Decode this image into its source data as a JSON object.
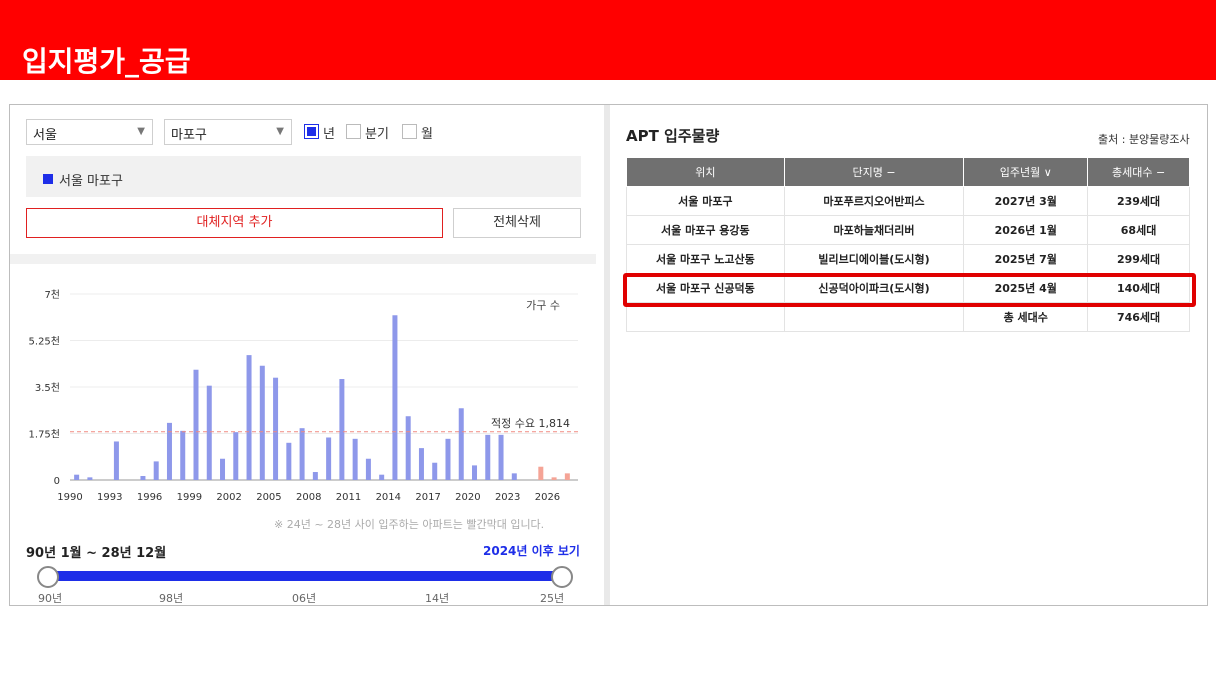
{
  "banner": {
    "title": "입지평가_공급"
  },
  "filters": {
    "city": "서울",
    "district": "마포구",
    "period_options": [
      {
        "label": "년",
        "checked": true
      },
      {
        "label": "분기",
        "checked": false
      },
      {
        "label": "월",
        "checked": false
      }
    ]
  },
  "region_list": {
    "item": "서울 마포구"
  },
  "buttons": {
    "add": "대체지역 추가",
    "clear": "전체삭제"
  },
  "chart_data": {
    "type": "bar",
    "legend_label": "가구 수",
    "y_ticks": [
      "7천",
      "5.25천",
      "3.5천",
      "1.75천",
      "0"
    ],
    "ylim": [
      0,
      7000
    ],
    "x_ticks": [
      "1990",
      "1993",
      "1996",
      "1999",
      "2002",
      "2005",
      "2008",
      "2011",
      "2014",
      "2017",
      "2020",
      "2023",
      "2026"
    ],
    "reference_line": {
      "label": "적정 수요 1,814",
      "value": 1814
    },
    "series": [
      {
        "values": [
          {
            "x": 1990,
            "y": 200
          },
          {
            "x": 1991,
            "y": 100
          },
          {
            "x": 1993,
            "y": 1450
          },
          {
            "x": 1995,
            "y": 150
          },
          {
            "x": 1996,
            "y": 700
          },
          {
            "x": 1997,
            "y": 2150
          },
          {
            "x": 1998,
            "y": 1850
          },
          {
            "x": 1999,
            "y": 4150
          },
          {
            "x": 2000,
            "y": 3550
          },
          {
            "x": 2001,
            "y": 800
          },
          {
            "x": 2002,
            "y": 1800
          },
          {
            "x": 2003,
            "y": 4700
          },
          {
            "x": 2004,
            "y": 4300
          },
          {
            "x": 2005,
            "y": 3850
          },
          {
            "x": 2006,
            "y": 1400
          },
          {
            "x": 2007,
            "y": 1950
          },
          {
            "x": 2008,
            "y": 300
          },
          {
            "x": 2009,
            "y": 1600
          },
          {
            "x": 2010,
            "y": 3800
          },
          {
            "x": 2011,
            "y": 1550
          },
          {
            "x": 2012,
            "y": 800
          },
          {
            "x": 2013,
            "y": 200
          },
          {
            "x": 2014,
            "y": 6200
          },
          {
            "x": 2015,
            "y": 2400
          },
          {
            "x": 2016,
            "y": 1200
          },
          {
            "x": 2017,
            "y": 650
          },
          {
            "x": 2018,
            "y": 1550
          },
          {
            "x": 2019,
            "y": 2700
          },
          {
            "x": 2020,
            "y": 550
          },
          {
            "x": 2021,
            "y": 1700
          },
          {
            "x": 2022,
            "y": 1700
          },
          {
            "x": 2023,
            "y": 250
          },
          {
            "x": 2025,
            "y": 500
          },
          {
            "x": 2026,
            "y": 100
          },
          {
            "x": 2027,
            "y": 250
          }
        ]
      }
    ],
    "highlight_from_year": 2024,
    "colors": {
      "past": "#8e98ea",
      "future": "#f5a496",
      "reference": "#f08a80"
    }
  },
  "chart_note": "※ 24년 ~ 28년 사이 입주하는 아파트는 빨간막대 입니다.",
  "range": {
    "label": "90년 1월 ~ 28년 12월",
    "after_link": "2024년 이후 보기",
    "ticks": [
      "90년",
      "98년",
      "06년",
      "14년",
      "25년"
    ]
  },
  "table": {
    "title": "APT 입주물량",
    "source": "출처 : 분양물량조사",
    "headers": [
      "위치",
      "단지명 −",
      "입주년월 ∨",
      "총세대수 −"
    ],
    "rows": [
      [
        "서울 마포구",
        "마포푸르지오어반피스",
        "2027년 3월",
        "239세대"
      ],
      [
        "서울 마포구 용강동",
        "마포하늘채더리버",
        "2026년 1월",
        "68세대"
      ],
      [
        "서울 마포구 노고산동",
        "빌리브디에이블(도시형)",
        "2025년 7월",
        "299세대"
      ],
      [
        "서울 마포구 신공덕동",
        "신공덕아이파크(도시형)",
        "2025년 4월",
        "140세대"
      ]
    ],
    "total": {
      "label": "총 세대수",
      "value": "746세대"
    },
    "highlight_color": "#e00000"
  }
}
